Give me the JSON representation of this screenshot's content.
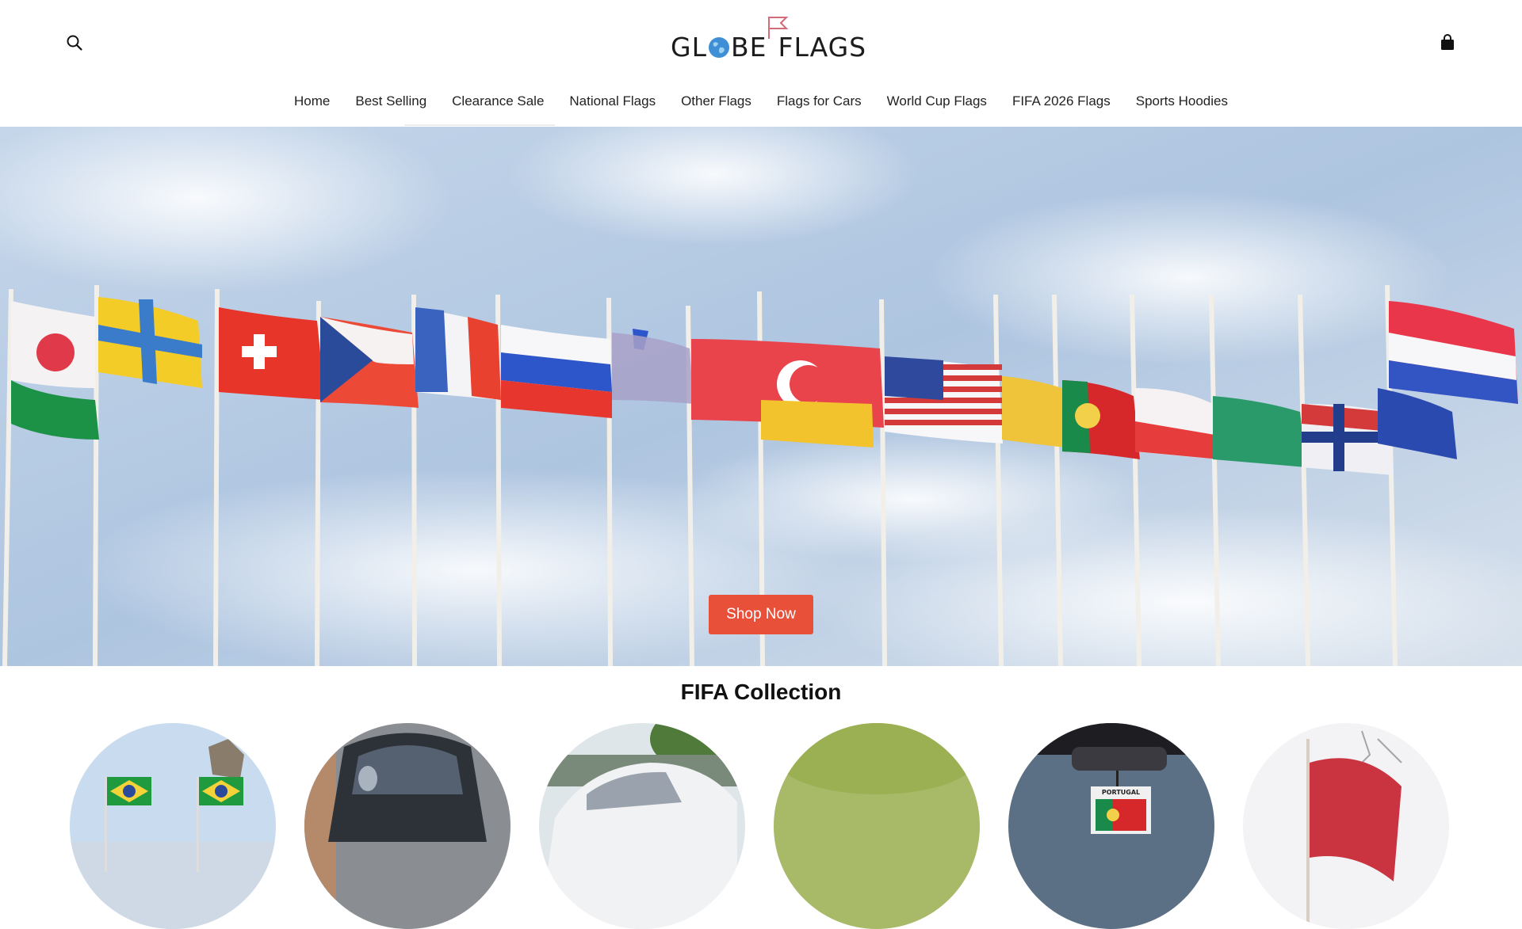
{
  "header": {
    "logo_text_left": "GL",
    "logo_text_mid": "BE",
    "logo_text_right": "FLAGS",
    "search_icon": "search-icon",
    "cart_icon": "shopping-bag-icon"
  },
  "nav": {
    "items": [
      {
        "label": "Home"
      },
      {
        "label": "Best Selling"
      },
      {
        "label": "Clearance Sale"
      },
      {
        "label": "National Flags"
      },
      {
        "label": "Other Flags"
      },
      {
        "label": "Flags for Cars"
      },
      {
        "label": "World Cup Flags"
      },
      {
        "label": "FIFA 2026 Flags"
      },
      {
        "label": "Sports Hoodies"
      }
    ]
  },
  "hero": {
    "button_label": "Shop Now",
    "button_color": "#e8503a"
  },
  "fifa": {
    "title": "FIFA Collection",
    "sticker_text": "PORTUGAL"
  }
}
